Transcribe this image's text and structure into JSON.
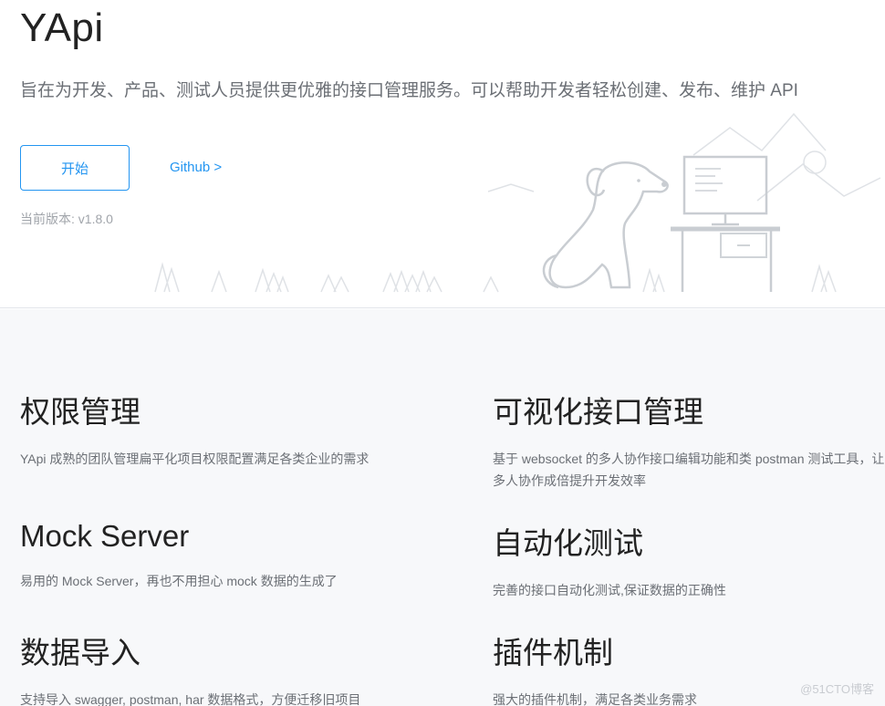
{
  "hero": {
    "brand": "YApi",
    "tagline": "旨在为开发、产品、测试人员提供更优雅的接口管理服务。可以帮助开发者轻松创建、发布、维护 API",
    "start_label": "开始",
    "github_label": "Github >",
    "version_text": "当前版本: v1.8.0"
  },
  "features": [
    {
      "title": "权限管理",
      "desc": "YApi 成熟的团队管理扁平化项目权限配置满足各类企业的需求"
    },
    {
      "title": "可视化接口管理",
      "desc": "基于 websocket 的多人协作接口编辑功能和类 postman 测试工具，让多人协作成倍提升开发效率"
    },
    {
      "title": "Mock Server",
      "desc": "易用的 Mock Server，再也不用担心 mock 数据的生成了"
    },
    {
      "title": "自动化测试",
      "desc": "完善的接口自动化测试,保证数据的正确性"
    },
    {
      "title": "数据导入",
      "desc": "支持导入 swagger, postman, har 数据格式，方便迁移旧项目"
    },
    {
      "title": "插件机制",
      "desc": "强大的插件机制，满足各类业务需求"
    }
  ],
  "watermark": "@51CTO博客",
  "colors": {
    "accent": "#2395f1",
    "feature_bg": "#f7f8fa"
  },
  "icons": {
    "illustration": "dog-desk-illustration"
  }
}
